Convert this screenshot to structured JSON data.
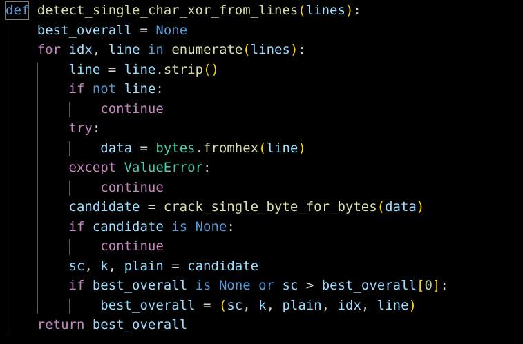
{
  "colors": {
    "background": "#000000",
    "keyword_blue": "#569cd6",
    "keyword_purple": "#c586c0",
    "function": "#dcdcaa",
    "variable": "#9cdcfe",
    "type": "#4ec9b0",
    "number": "#b5cea8",
    "bracket": "#ffd700",
    "text": "#d4d4d4"
  },
  "code": {
    "lines": [
      {
        "tokens": [
          {
            "t": "def",
            "c": "keyword_blue"
          },
          {
            "t": " ",
            "c": "text"
          },
          {
            "t": "detect_single_char_xor_from_lines",
            "c": "function"
          },
          {
            "t": "(",
            "c": "bracket"
          },
          {
            "t": "lines",
            "c": "variable"
          },
          {
            "t": ")",
            "c": "bracket"
          },
          {
            "t": ":",
            "c": "text"
          }
        ]
      },
      {
        "tokens": [
          {
            "t": "    ",
            "c": "text"
          },
          {
            "t": "best_overall",
            "c": "variable"
          },
          {
            "t": " = ",
            "c": "text"
          },
          {
            "t": "None",
            "c": "keyword_blue"
          }
        ]
      },
      {
        "tokens": [
          {
            "t": "    ",
            "c": "text"
          },
          {
            "t": "for",
            "c": "keyword_purple"
          },
          {
            "t": " ",
            "c": "text"
          },
          {
            "t": "idx",
            "c": "variable"
          },
          {
            "t": ", ",
            "c": "text"
          },
          {
            "t": "line",
            "c": "variable"
          },
          {
            "t": " ",
            "c": "text"
          },
          {
            "t": "in",
            "c": "keyword_blue"
          },
          {
            "t": " ",
            "c": "text"
          },
          {
            "t": "enumerate",
            "c": "function"
          },
          {
            "t": "(",
            "c": "bracket"
          },
          {
            "t": "lines",
            "c": "variable"
          },
          {
            "t": ")",
            "c": "bracket"
          },
          {
            "t": ":",
            "c": "text"
          }
        ]
      },
      {
        "tokens": [
          {
            "t": "        ",
            "c": "text"
          },
          {
            "t": "line",
            "c": "variable"
          },
          {
            "t": " = ",
            "c": "text"
          },
          {
            "t": "line",
            "c": "variable"
          },
          {
            "t": ".",
            "c": "text"
          },
          {
            "t": "strip",
            "c": "function"
          },
          {
            "t": "()",
            "c": "bracket"
          }
        ]
      },
      {
        "tokens": [
          {
            "t": "        ",
            "c": "text"
          },
          {
            "t": "if",
            "c": "keyword_purple"
          },
          {
            "t": " ",
            "c": "text"
          },
          {
            "t": "not",
            "c": "keyword_blue"
          },
          {
            "t": " ",
            "c": "text"
          },
          {
            "t": "line",
            "c": "variable"
          },
          {
            "t": ":",
            "c": "text"
          }
        ]
      },
      {
        "tokens": [
          {
            "t": "            ",
            "c": "text"
          },
          {
            "t": "continue",
            "c": "keyword_purple"
          }
        ]
      },
      {
        "tokens": [
          {
            "t": "        ",
            "c": "text"
          },
          {
            "t": "try",
            "c": "keyword_purple"
          },
          {
            "t": ":",
            "c": "text"
          }
        ]
      },
      {
        "tokens": [
          {
            "t": "            ",
            "c": "text"
          },
          {
            "t": "data",
            "c": "variable"
          },
          {
            "t": " = ",
            "c": "text"
          },
          {
            "t": "bytes",
            "c": "type"
          },
          {
            "t": ".",
            "c": "text"
          },
          {
            "t": "fromhex",
            "c": "function"
          },
          {
            "t": "(",
            "c": "bracket"
          },
          {
            "t": "line",
            "c": "variable"
          },
          {
            "t": ")",
            "c": "bracket"
          }
        ]
      },
      {
        "tokens": [
          {
            "t": "        ",
            "c": "text"
          },
          {
            "t": "except",
            "c": "keyword_purple"
          },
          {
            "t": " ",
            "c": "text"
          },
          {
            "t": "ValueError",
            "c": "type"
          },
          {
            "t": ":",
            "c": "text"
          }
        ]
      },
      {
        "tokens": [
          {
            "t": "            ",
            "c": "text"
          },
          {
            "t": "continue",
            "c": "keyword_purple"
          }
        ]
      },
      {
        "tokens": [
          {
            "t": "        ",
            "c": "text"
          },
          {
            "t": "candidate",
            "c": "variable"
          },
          {
            "t": " = ",
            "c": "text"
          },
          {
            "t": "crack_single_byte_for_bytes",
            "c": "function"
          },
          {
            "t": "(",
            "c": "bracket"
          },
          {
            "t": "data",
            "c": "variable"
          },
          {
            "t": ")",
            "c": "bracket"
          }
        ]
      },
      {
        "tokens": [
          {
            "t": "        ",
            "c": "text"
          },
          {
            "t": "if",
            "c": "keyword_purple"
          },
          {
            "t": " ",
            "c": "text"
          },
          {
            "t": "candidate",
            "c": "variable"
          },
          {
            "t": " ",
            "c": "text"
          },
          {
            "t": "is",
            "c": "keyword_blue"
          },
          {
            "t": " ",
            "c": "text"
          },
          {
            "t": "None",
            "c": "keyword_blue"
          },
          {
            "t": ":",
            "c": "text"
          }
        ]
      },
      {
        "tokens": [
          {
            "t": "            ",
            "c": "text"
          },
          {
            "t": "continue",
            "c": "keyword_purple"
          }
        ]
      },
      {
        "tokens": [
          {
            "t": "        ",
            "c": "text"
          },
          {
            "t": "sc",
            "c": "variable"
          },
          {
            "t": ", ",
            "c": "text"
          },
          {
            "t": "k",
            "c": "variable"
          },
          {
            "t": ", ",
            "c": "text"
          },
          {
            "t": "plain",
            "c": "variable"
          },
          {
            "t": " = ",
            "c": "text"
          },
          {
            "t": "candidate",
            "c": "variable"
          }
        ]
      },
      {
        "tokens": [
          {
            "t": "        ",
            "c": "text"
          },
          {
            "t": "if",
            "c": "keyword_purple"
          },
          {
            "t": " ",
            "c": "text"
          },
          {
            "t": "best_overall",
            "c": "variable"
          },
          {
            "t": " ",
            "c": "text"
          },
          {
            "t": "is",
            "c": "keyword_blue"
          },
          {
            "t": " ",
            "c": "text"
          },
          {
            "t": "None",
            "c": "keyword_blue"
          },
          {
            "t": " ",
            "c": "text"
          },
          {
            "t": "or",
            "c": "keyword_blue"
          },
          {
            "t": " ",
            "c": "text"
          },
          {
            "t": "sc",
            "c": "variable"
          },
          {
            "t": " > ",
            "c": "text"
          },
          {
            "t": "best_overall",
            "c": "variable"
          },
          {
            "t": "[",
            "c": "bracket"
          },
          {
            "t": "0",
            "c": "number"
          },
          {
            "t": "]",
            "c": "bracket"
          },
          {
            "t": ":",
            "c": "text"
          }
        ]
      },
      {
        "tokens": [
          {
            "t": "            ",
            "c": "text"
          },
          {
            "t": "best_overall",
            "c": "variable"
          },
          {
            "t": " = ",
            "c": "text"
          },
          {
            "t": "(",
            "c": "bracket"
          },
          {
            "t": "sc",
            "c": "variable"
          },
          {
            "t": ", ",
            "c": "text"
          },
          {
            "t": "k",
            "c": "variable"
          },
          {
            "t": ", ",
            "c": "text"
          },
          {
            "t": "plain",
            "c": "variable"
          },
          {
            "t": ", ",
            "c": "text"
          },
          {
            "t": "idx",
            "c": "variable"
          },
          {
            "t": ", ",
            "c": "text"
          },
          {
            "t": "line",
            "c": "variable"
          },
          {
            "t": ")",
            "c": "bracket"
          }
        ]
      },
      {
        "tokens": [
          {
            "t": "    ",
            "c": "text"
          },
          {
            "t": "return",
            "c": "keyword_purple"
          },
          {
            "t": " ",
            "c": "text"
          },
          {
            "t": "best_overall",
            "c": "variable"
          }
        ]
      }
    ]
  }
}
